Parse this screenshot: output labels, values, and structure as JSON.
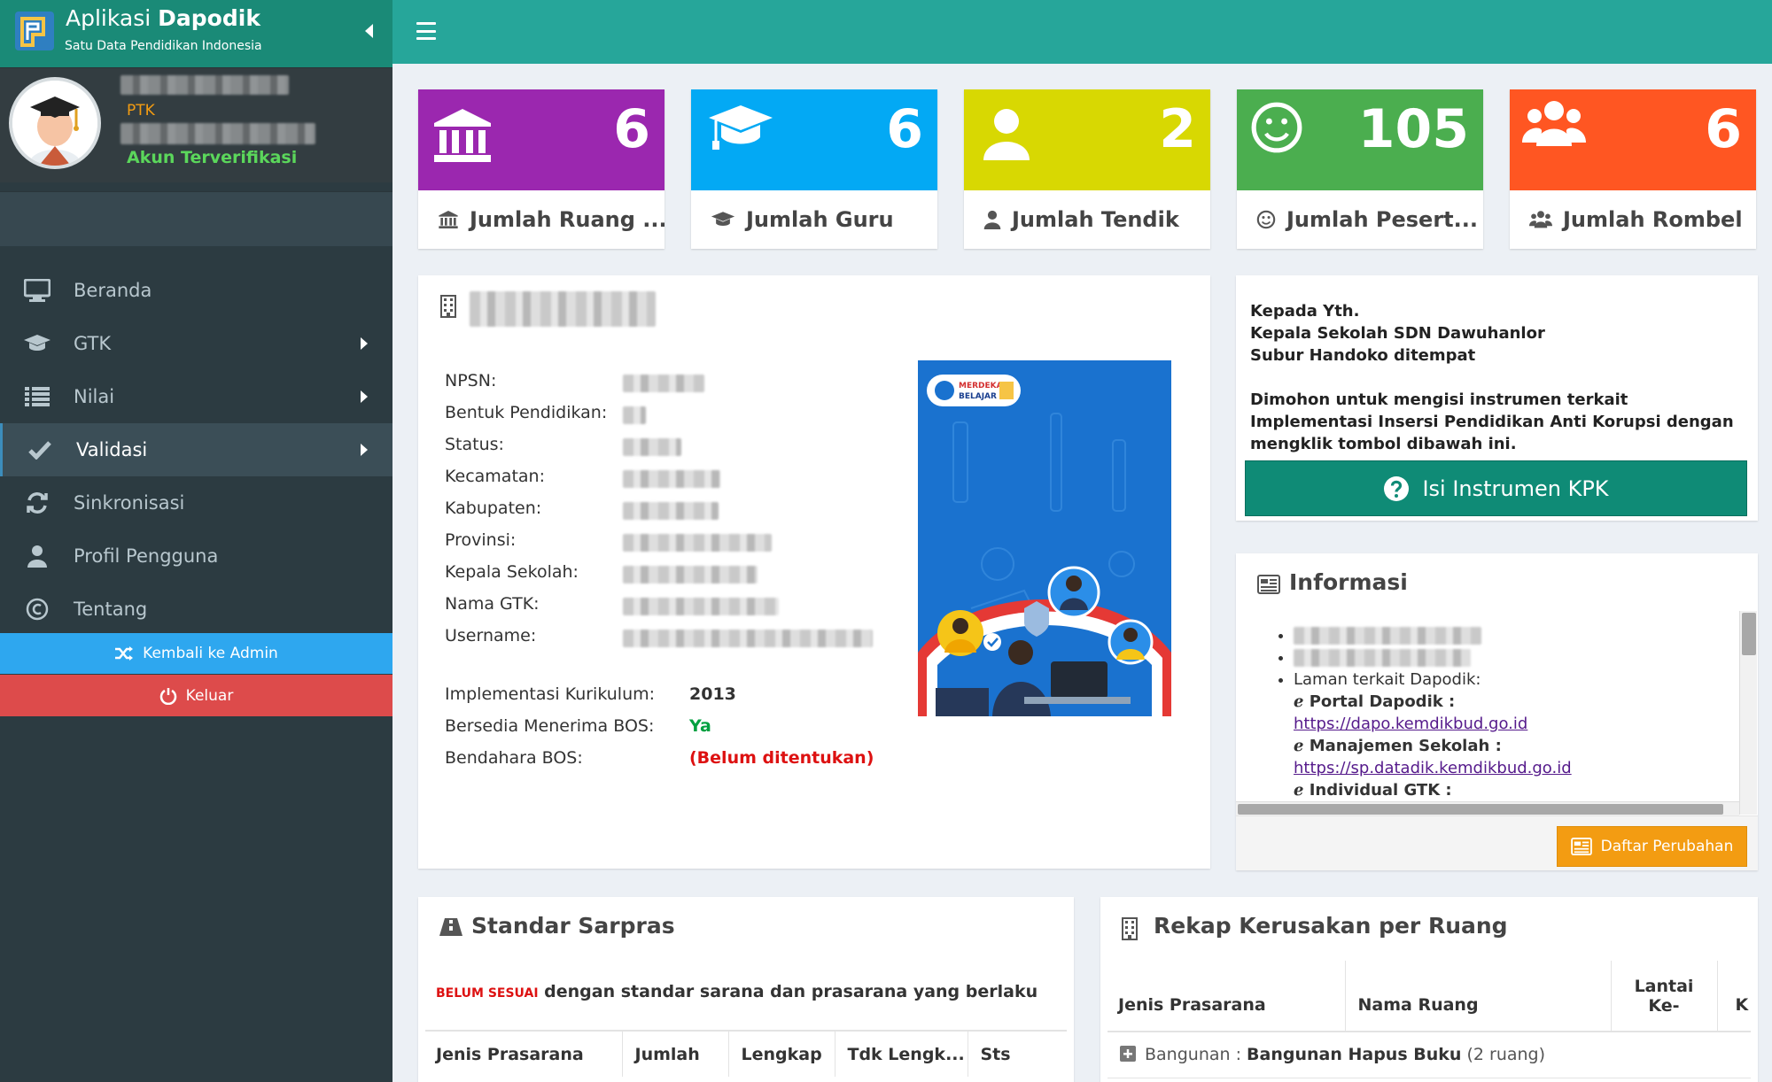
{
  "app": {
    "title_plain": "Aplikasi",
    "title_bold": "Dapodik",
    "subtitle": "Satu Data Pendidikan Indonesia"
  },
  "user": {
    "role": "PTK",
    "verified": "Akun Terverifikasi"
  },
  "menu": [
    {
      "label": "Beranda",
      "icon": "desktop-icon"
    },
    {
      "label": "GTK",
      "icon": "graduation-cap-icon",
      "has_sub": true
    },
    {
      "label": "Nilai",
      "icon": "list-icon",
      "has_sub": true
    },
    {
      "label": "Validasi",
      "icon": "check-icon",
      "has_sub": true,
      "active": true
    },
    {
      "label": "Sinkronisasi",
      "icon": "refresh-icon"
    },
    {
      "label": "Profil Pengguna",
      "icon": "user-icon"
    },
    {
      "label": "Tentang",
      "icon": "copyright-icon"
    }
  ],
  "actions": {
    "admin": "Kembali ke Admin",
    "logout": "Keluar"
  },
  "stats": [
    {
      "value": "6",
      "label": "Jumlah Ruang ...",
      "color": "#9b27af",
      "icon": "bank-icon"
    },
    {
      "value": "6",
      "label": "Jumlah Guru",
      "color": "#03a9f4",
      "icon": "graduation-cap-icon"
    },
    {
      "value": "2",
      "label": "Jumlah Tendik",
      "color": "#d8d802",
      "icon": "user-icon"
    },
    {
      "value": "105",
      "label": "Jumlah Pesert...",
      "color": "#4bae4f",
      "icon": "smile-icon"
    },
    {
      "value": "6",
      "label": "Jumlah Rombel",
      "color": "#ff5622",
      "icon": "users-icon"
    }
  ],
  "school": {
    "labels": [
      "NPSN:",
      "Bentuk Pendidikan:",
      "Status:",
      "Kecamatan:",
      "Kabupaten:",
      "Provinsi:",
      "Kepala Sekolah:",
      "Nama GTK:",
      "Username:"
    ],
    "kurikulum_label": "Implementasi Kurikulum:",
    "kurikulum_value": "2013",
    "bos_label": "Bersedia Menerima BOS:",
    "bos_value": "Ya",
    "bendahara_label": "Bendahara BOS:",
    "bendahara_value": "(Belum ditentukan)",
    "poster_badge_line1": "MERDEKA",
    "poster_badge_line2": "BELAJAR"
  },
  "notice": {
    "lines": [
      "Kepada Yth.",
      "Kepala Sekolah SDN Dawuhanlor",
      "Subur Handoko ditempat",
      "",
      "Dimohon untuk mengisi instrumen terkait Implementasi Insersi Pendidikan Anti Korupsi dengan mengklik tombol dibawah ini."
    ],
    "button": "Isi Instrumen KPK"
  },
  "info": {
    "title": "Informasi",
    "related": "Laman terkait Dapodik:",
    "links": [
      {
        "name": "Portal Dapodik :",
        "url": "https://dapo.kemdikbud.go.id"
      },
      {
        "name": "Manajemen Sekolah :",
        "url": "https://sp.datadik.kemdikbud.go.id"
      },
      {
        "name": "Individual GTK :",
        "url": ""
      }
    ],
    "button": "Daftar Perubahan"
  },
  "sarpras": {
    "title": "Standar Sarpras",
    "status": "BELUM SESUAI",
    "status_text": "dengan standar sarana dan prasarana yang berlaku",
    "columns": [
      "Jenis Prasarana",
      "Jumlah",
      "Lengkap",
      "Tdk Lengk...",
      "Sts"
    ]
  },
  "rekap": {
    "title": "Rekap Kerusakan per Ruang",
    "columns": [
      "Jenis Prasarana",
      "Nama Ruang",
      "Lantai Ke-",
      "K"
    ],
    "group_prefix": "Bangunan : ",
    "group_name": "Bangunan Hapus Buku",
    "group_count": "(2 ruang)"
  }
}
